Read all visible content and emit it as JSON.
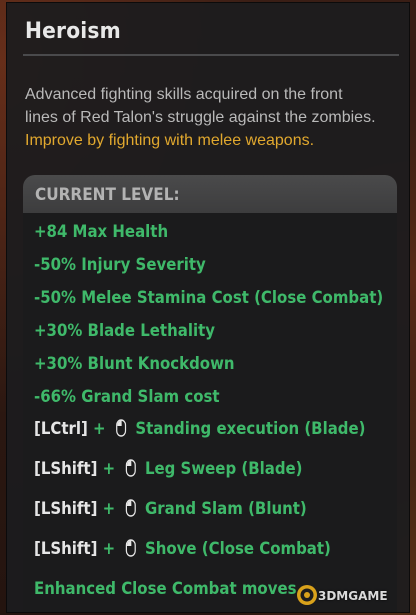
{
  "skill": {
    "title": "Heroism",
    "description_lines": [
      "Advanced fighting skills acquired on the front",
      "lines of Red Talon's struggle against the zombies."
    ],
    "hint": "Improve by fighting with melee weapons."
  },
  "level": {
    "header": "CURRENT LEVEL:",
    "effects": [
      {
        "text": "+84 Max Health"
      },
      {
        "text": "-50% Injury Severity"
      },
      {
        "text": "-50% Melee Stamina Cost (Close Combat)"
      },
      {
        "text": "+30% Blade Lethality"
      },
      {
        "text": "+30% Blunt Knockdown"
      },
      {
        "text": "-66% Grand Slam cost"
      }
    ],
    "combos": [
      {
        "key": "[LCtrl]",
        "plus": "+",
        "icon": "mouse-icon",
        "action": "Standing execution (Blade)"
      },
      {
        "key": "[LShift]",
        "plus": "+",
        "icon": "mouse-icon",
        "action": "Leg Sweep (Blade)"
      },
      {
        "key": "[LShift]",
        "plus": "+",
        "icon": "mouse-icon",
        "action": "Grand Slam (Blunt)"
      },
      {
        "key": "[LShift]",
        "plus": "+",
        "icon": "mouse-icon",
        "action": "Shove (Close Combat)"
      }
    ],
    "footer_effect": "Enhanced Close Combat moves"
  },
  "watermark": {
    "text": "3DMGAME"
  },
  "colors": {
    "positive": "#3fb96a",
    "hint": "#e1a82e",
    "key": "#e6e6e6"
  }
}
